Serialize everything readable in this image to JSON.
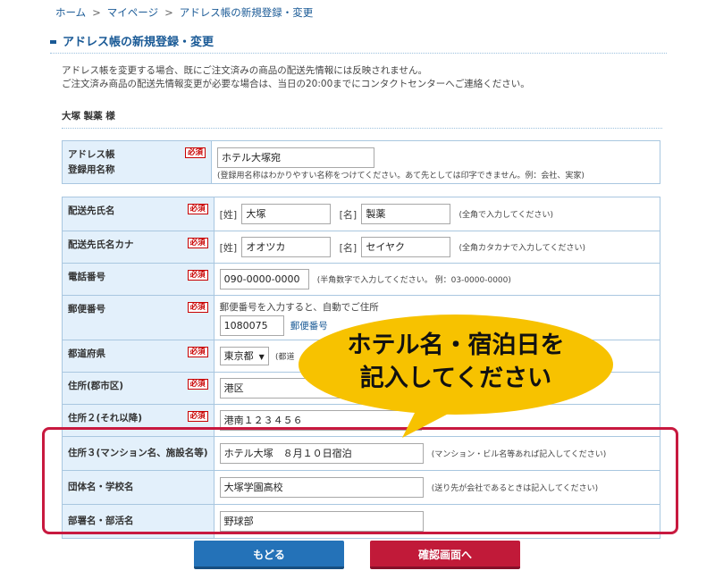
{
  "breadcrumb": {
    "home": "ホーム",
    "sep": ">",
    "mypage": "マイページ",
    "current": "アドレス帳の新規登録・変更"
  },
  "page_title": "アドレス帳の新規登録・変更",
  "notice": {
    "line1": "アドレス帳を変更する場合、既にご注文済みの商品の配送先情報には反映されません。",
    "line2": "ご注文済み商品の配送先情報変更が必要な場合は、当日の20:00までにコンタクトセンターへご連絡ください。"
  },
  "customer_name": "大塚 製薬 様",
  "required_label": "必須",
  "fields": {
    "address_book_name": {
      "label1": "アドレス帳",
      "label2": "登録用名称",
      "value": "ホテル大塚宛",
      "hint": "(登録用名称はわかりやすい名称をつけてください。あて先としては印字できません。例：会社、実家)"
    },
    "recipient_name": {
      "label": "配送先氏名",
      "last_bracket": "[姓]",
      "last_value": "大塚",
      "first_bracket": "[名]",
      "first_value": "製薬",
      "hint": "(全角で入力してください)"
    },
    "recipient_kana": {
      "label": "配送先氏名カナ",
      "last_bracket": "[姓]",
      "last_value": "オオツカ",
      "first_bracket": "[名]",
      "first_value": "セイヤク",
      "hint": "(全角カタカナで入力してください)"
    },
    "phone": {
      "label": "電話番号",
      "value": "090-0000-0000",
      "hint": "(半角数字で入力してください。 例：03-0000-0000)"
    },
    "postal": {
      "label": "郵便番号",
      "instruction": "郵便番号を入力すると、自動でご住所",
      "value": "1080075",
      "link": "郵便番号"
    },
    "prefecture": {
      "label": "都道府県",
      "value": "東京都",
      "hint": "(都道"
    },
    "city": {
      "label": "住所(郡市区)",
      "value": "港区"
    },
    "address2": {
      "label": "住所２(それ以降)",
      "value": "港南１２３４５６"
    },
    "address3": {
      "label": "住所３(マンション名、施設名等)",
      "value": "ホテル大塚　８月１０日宿泊",
      "hint": "(マンション・ビル名等あれば記入してください)"
    },
    "organization": {
      "label": "団体名・学校名",
      "value": "大塚学園高校",
      "hint": "(送り先が会社であるときは記入してください)"
    },
    "department": {
      "label": "部署名・部活名",
      "value": "野球部"
    }
  },
  "callout": {
    "line1": "ホテル名・宿泊日を",
    "line2": "記入してください"
  },
  "buttons": {
    "back": "もどる",
    "confirm": "確認画面へ"
  },
  "colors": {
    "link_blue": "#1a5a96",
    "header_bg": "#e3f0fb",
    "highlight_red": "#c8193f",
    "callout_yellow": "#f7c200",
    "back_button": "#2472b8",
    "confirm_button": "#c11a39"
  }
}
